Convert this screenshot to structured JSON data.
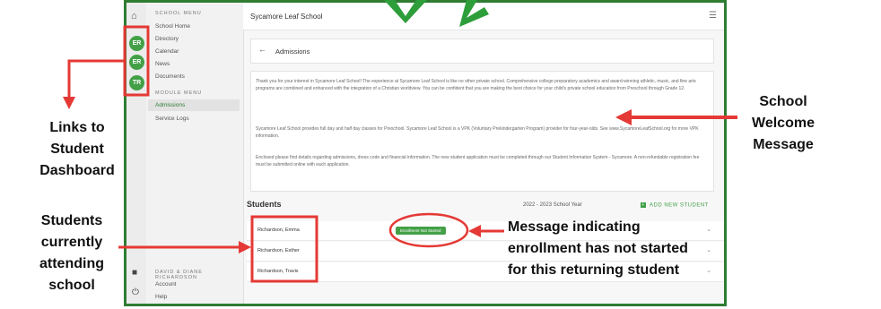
{
  "app": {
    "school_name": "Sycamore Leaf School",
    "page_title": "Admissions"
  },
  "rail": {
    "avatars": [
      "ER",
      "ER",
      "TR"
    ]
  },
  "menu": {
    "school_menu_heading": "SCHOOL MENU",
    "school_items": [
      "School Home",
      "Directory",
      "Calendar",
      "News",
      "Documents"
    ],
    "module_menu_heading": "MODULE MENU",
    "module_items": [
      "Admissions",
      "Service Logs"
    ],
    "family_name": "DAVID & DIANE RICHARDSON",
    "account_label": "Account",
    "help_label": "Help"
  },
  "welcome": {
    "paragraphs": [
      "Thank you for your interest in Sycamore Leaf School! The experience at Sycamore Leaf School is like no other private school. Comprehensive college preparatory academics and award-winning athletic, music, and fine arts programs are combined and enhanced with the integration of a Christian worldview. You can be confident that you are making the best choice for your child's private school education from Preschool through Grade 12.",
      "Sycamore Leaf School provides full day and half day classes for Preschool. Sycamore Leaf School is a VPK (Voluntary Prekindergarten Program) provider for four-year-olds. See www.SycamoreLeafSchool.org for more VPK information.",
      "Enclosed please find details regarding admissions, dress code and financial information. The new student application must be completed through our Student Information System - Sycamore. A non-refundable registration fee must be submitted online with each application."
    ]
  },
  "students": {
    "heading": "Students",
    "school_year": "2022 - 2023 School Year",
    "add_new_label": "ADD NEW STUDENT",
    "rows": [
      {
        "name": "Richardson, Emma",
        "badge": "Enrollment Not Started"
      },
      {
        "name": "Richardson, Esther",
        "badge": ""
      },
      {
        "name": "Richardson, Travis",
        "badge": ""
      }
    ]
  },
  "annotations": {
    "links_to_dashboard": [
      "Links to",
      "Student",
      "Dashboard"
    ],
    "students_attending": [
      "Students",
      "currently",
      "attending",
      "school"
    ],
    "welcome_message": [
      "School",
      "Welcome",
      "Message"
    ],
    "enrollment_message": [
      "Message indicating",
      "enrollment has not started",
      "for this returning student"
    ]
  },
  "colors": {
    "frame_border": "#2e7d32",
    "accent_green": "#43a047",
    "annotation_red": "#e53935"
  }
}
